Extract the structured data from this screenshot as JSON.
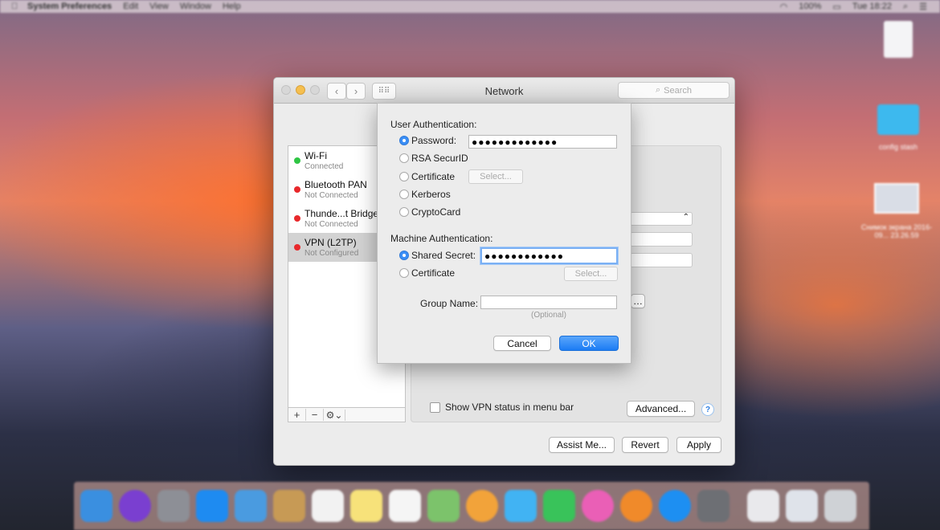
{
  "menubar": {
    "app_name": "System Preferences",
    "items": [
      "Edit",
      "View",
      "Window",
      "Help"
    ],
    "battery": "100%",
    "clock": "Tue 18:22"
  },
  "desktop": {
    "icons": [
      {
        "label": "",
        "icon": "document-icon"
      },
      {
        "label": "config stash",
        "icon": "folder-icon"
      },
      {
        "label": "Снимок экрана 2016-09... 23.26.59",
        "icon": "screenshot-icon"
      }
    ]
  },
  "window": {
    "title": "Network",
    "search_placeholder": "Search",
    "services": [
      {
        "name": "Wi-Fi",
        "status": "Connected",
        "dot_color": "#2fc544"
      },
      {
        "name": "Bluetooth PAN",
        "status": "Not Connected",
        "dot_color": "#e8282b"
      },
      {
        "name": "Thunde...t Bridge",
        "status": "Not Connected",
        "dot_color": "#e8282b"
      },
      {
        "name": "VPN (L2TP)",
        "status": "Not Configured",
        "dot_color": "#e8282b"
      }
    ],
    "toolbar": {
      "add": "+",
      "remove": "−",
      "gear": "⚙⌄"
    },
    "show_vpn_label": "Show VPN status in menu bar",
    "advanced_label": "Advanced...",
    "help_label": "?",
    "assist_label": "Assist Me...",
    "revert_label": "Revert",
    "apply_label": "Apply"
  },
  "sheet": {
    "user_auth_title": "User Authentication:",
    "user_options": [
      {
        "label": "Password:",
        "selected": true
      },
      {
        "label": "RSA SecurID",
        "selected": false
      },
      {
        "label": "Certificate",
        "selected": false
      },
      {
        "label": "Kerberos",
        "selected": false
      },
      {
        "label": "CryptoCard",
        "selected": false
      }
    ],
    "password_value": "●●●●●●●●●●●●●",
    "user_cert_select": "Select...",
    "machine_auth_title": "Machine Authentication:",
    "machine_options": [
      {
        "label": "Shared Secret:",
        "selected": true
      },
      {
        "label": "Certificate",
        "selected": false
      }
    ],
    "shared_secret_value": "●●●●●●●●●●●●",
    "machine_cert_select": "Select...",
    "group_name_label": "Group Name:",
    "group_name_value": "",
    "optional_hint": "(Optional)",
    "cancel_label": "Cancel",
    "ok_label": "OK"
  },
  "dock": {
    "apps": [
      "Finder",
      "Siri",
      "Launchpad",
      "Safari",
      "Mail",
      "Contacts",
      "Calendar",
      "Notes",
      "Reminders",
      "Maps",
      "Photos",
      "Messages",
      "FaceTime",
      "iTunes",
      "iBooks",
      "App Store",
      "System Preferences",
      "Document",
      "Screenshot",
      "Trash"
    ],
    "colors": [
      "#3a8fe0",
      "#7a3fd0",
      "#8d8f96",
      "#1e8bf1",
      "#4a9be0",
      "#c79a55",
      "#f2f2f2",
      "#f7e27a",
      "#f5f5f5",
      "#7cc36b",
      "#f2a33a",
      "#41b3f3",
      "#39c35a",
      "#ea5fb6",
      "#f08a2a",
      "#1d8ff2",
      "#6d6f74",
      "#e9e9ec",
      "#dfe3ea",
      "#cfd2d6"
    ]
  }
}
